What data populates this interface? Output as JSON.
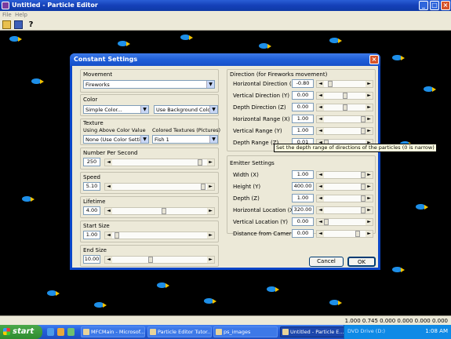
{
  "window": {
    "title": "Untitled - Particle Editor"
  },
  "menu": [
    "File",
    "Help"
  ],
  "toolbar": {
    "icons": [
      "open-icon",
      "save-icon",
      "help-icon"
    ]
  },
  "status": {
    "text": "1.000 0.745 0.000 0.000 0.000 0.000"
  },
  "dialog": {
    "title": "Constant Settings",
    "movement": {
      "label": "Movement",
      "value": "Fireworks"
    },
    "color": {
      "label": "Color",
      "value": "Simple Color...",
      "bg_value": "Use Background Color..."
    },
    "texture": {
      "label": "Texture",
      "using_label": "Using Above Color Value",
      "colored_label": "Colored Textures (Pictures)",
      "using_value": "None (Use Color Settings)",
      "colored_value": "Fish 1"
    },
    "number_per_second": {
      "label": "Number Per Second",
      "value": "250",
      "level": 0.95
    },
    "speed": {
      "label": "Speed",
      "value": "5.10",
      "level": 0.98
    },
    "lifetime": {
      "label": "Lifetime",
      "value": "4.00",
      "level": 0.55
    },
    "start_size": {
      "label": "Start Size",
      "value": "1.00",
      "level": 0.03
    },
    "end_size": {
      "label": "End Size",
      "value": "10.00",
      "level": 0.4
    },
    "direction": {
      "label": "Direction (for Fireworks movement)",
      "rows": [
        {
          "label": "Horizontal Direction (X)",
          "value": "-0.80",
          "level": 0.1
        },
        {
          "label": "Vertical Direction (Y)",
          "value": "0.00",
          "level": 0.5
        },
        {
          "label": "Depth Direction (Z)",
          "value": "0.00",
          "level": 0.5
        },
        {
          "label": "Horizontal Range (X)",
          "value": "1.00",
          "level": 1.0
        },
        {
          "label": "Vertical Range (Y)",
          "value": "1.00",
          "level": 1.0
        },
        {
          "label": "Depth Range (Z)",
          "value": "0.01",
          "level": 0.0
        }
      ]
    },
    "tooltip": "Set the depth range of directions of the particles (0 is narrow)",
    "emitter": {
      "label": "Emitter Settings",
      "rows": [
        {
          "label": "Width (X)",
          "value": "1.00",
          "level": 1.0
        },
        {
          "label": "Height (Y)",
          "value": "400.00",
          "level": 1.0
        },
        {
          "label": "Depth (Z)",
          "value": "1.00",
          "level": 1.0
        },
        {
          "label": "Horizontal Location (X)",
          "value": "320.00",
          "level": 1.0
        },
        {
          "label": "Vertical Location (Y)",
          "value": "0.00",
          "level": 0.0
        },
        {
          "label": "Distance from Camera (Z)",
          "value": "0.00",
          "level": 0.85
        }
      ]
    },
    "cancel": "Cancel",
    "ok": "OK"
  },
  "taskbar": {
    "start": "start",
    "tasks": [
      {
        "label": "MFCMain - Microsof...",
        "active": false
      },
      {
        "label": "Particle Editor Tutor...",
        "active": false
      },
      {
        "label": "ps_images",
        "active": false
      },
      {
        "label": "Untitled - Particle E...",
        "active": true
      }
    ],
    "drive": "DVD Drive (D:)",
    "clock": "1:08 AM"
  }
}
